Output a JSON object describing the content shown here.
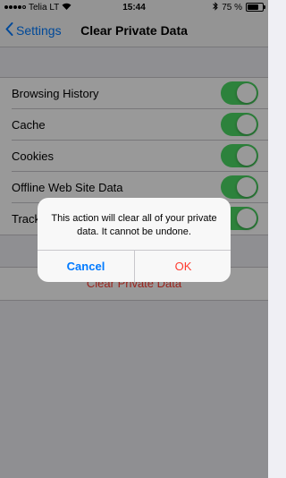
{
  "status_bar": {
    "carrier": "Telia LT",
    "time": "15:44",
    "battery_text": "75 %",
    "battery_level": 0.75,
    "signal_bars_filled": 4,
    "signal_bars_total": 5
  },
  "nav": {
    "back_label": "Settings",
    "title": "Clear Private Data"
  },
  "list": {
    "items": [
      {
        "label": "Browsing History",
        "enabled": true
      },
      {
        "label": "Cache",
        "enabled": true
      },
      {
        "label": "Cookies",
        "enabled": true
      },
      {
        "label": "Offline Web Site Data",
        "enabled": true
      },
      {
        "label": "Tracking Protection",
        "enabled": true
      }
    ]
  },
  "clear_button": {
    "label": "Clear Private Data"
  },
  "alert": {
    "message": "This action will clear all of your private data. It cannot be undone.",
    "cancel_label": "Cancel",
    "ok_label": "OK"
  },
  "colors": {
    "accent": "#007aff",
    "destructive": "#ff3b30",
    "toggle_on": "#4cd964"
  },
  "icons": [
    "wifi-icon",
    "bluetooth-icon",
    "battery-icon",
    "chevron-left-icon"
  ]
}
